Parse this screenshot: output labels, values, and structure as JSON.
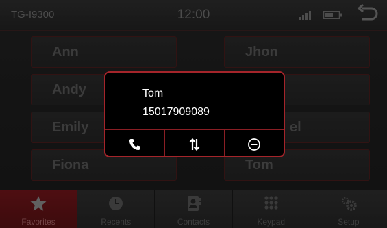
{
  "status": {
    "device": "TG-I9300",
    "time": "12:00"
  },
  "contacts": [
    "Ann",
    "Jhon",
    "Andy",
    "",
    "Emily",
    "el",
    "Fiona",
    "Tom"
  ],
  "dialog": {
    "name": "Tom",
    "number": "15017909089"
  },
  "actions": [
    {
      "icon": "phone-call-icon"
    },
    {
      "icon": "transfer-arrows-icon"
    },
    {
      "icon": "minus-circle-icon"
    }
  ],
  "tabs": [
    {
      "label": "Favorites",
      "icon": "star-icon",
      "active": true
    },
    {
      "label": "Recents",
      "icon": "clock-icon",
      "active": false
    },
    {
      "label": "Contacts",
      "icon": "contacts-book-icon",
      "active": false
    },
    {
      "label": "Keypad",
      "icon": "keypad-icon",
      "active": false
    },
    {
      "label": "Setup",
      "icon": "gear-icon",
      "active": false
    }
  ],
  "colors": {
    "accent": "#a4242a",
    "tab_active": "#8e1b21"
  }
}
